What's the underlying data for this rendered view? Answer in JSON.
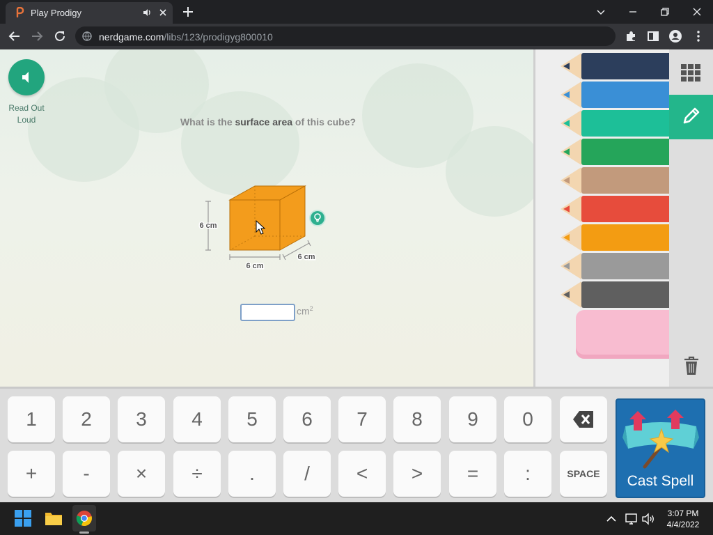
{
  "browser": {
    "tab_title": "Play Prodigy",
    "url_domain": "nerdgame.com",
    "url_path": "/libs/123/prodigyg800010"
  },
  "game": {
    "read_aloud_label": "Read Out Loud",
    "question_prefix": "What is the ",
    "question_emphasis": "surface area",
    "question_suffix": " of this cube?",
    "dimension_height": "6 cm",
    "dimension_width": "6 cm",
    "dimension_depth": "6 cm",
    "cube_color": "#f39c1c",
    "answer_value": "",
    "answer_unit": "cm",
    "answer_unit_exponent": "2"
  },
  "tools": {
    "pencil_colors": [
      "#2c3e5c",
      "#3a8fd6",
      "#1dbf98",
      "#25a55a",
      "#c29a7c",
      "#e74c3c",
      "#f39c12",
      "#9a9a9a",
      "#5f5f5f"
    ],
    "eraser_color": "#f8bcd0",
    "active_tool": "pencil-icon",
    "accent": "#23b68b"
  },
  "keypad": {
    "row1": [
      "1",
      "2",
      "3",
      "4",
      "5",
      "6",
      "7",
      "8",
      "9",
      "0"
    ],
    "row2": [
      "+",
      "-",
      "×",
      "÷",
      ".",
      "/",
      "<",
      ">",
      "=",
      ":"
    ],
    "backspace_icon": "backspace-icon",
    "space_label": "SPACE",
    "cast_spell_label": "Cast Spell"
  },
  "taskbar": {
    "time": "3:07 PM",
    "date": "4/4/2022"
  }
}
